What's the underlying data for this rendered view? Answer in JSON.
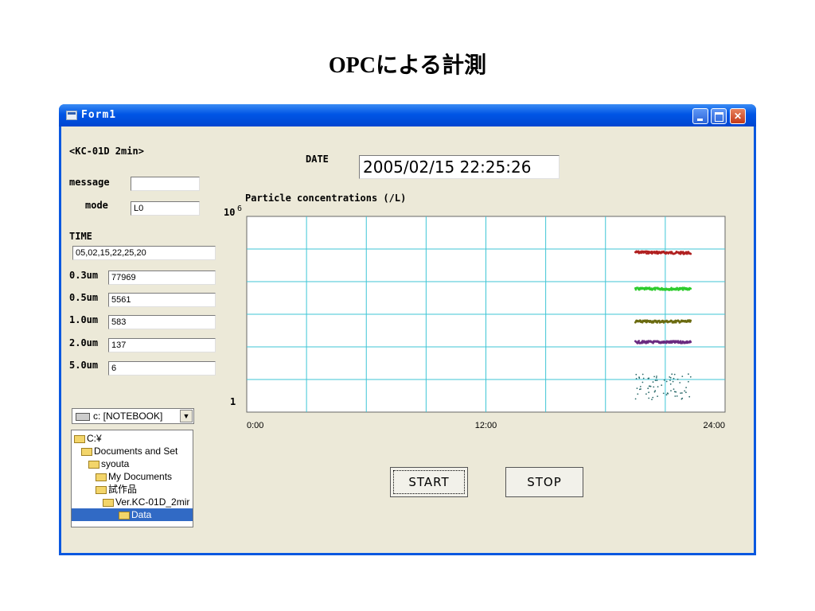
{
  "slide": {
    "title": "OPCによる計測"
  },
  "window": {
    "title": "Form1"
  },
  "form": {
    "model_label": "<KC-01D 2min>",
    "message_label": "message",
    "message_value": "",
    "mode_label": "mode",
    "mode_value": "L0",
    "time_label": "TIME",
    "time_value": "05,02,15,22,25,20",
    "date_label": "DATE",
    "date_value": "2005/02/15 22:25:26",
    "counts": [
      {
        "label": "0.3um",
        "value": "77969"
      },
      {
        "label": "0.5um",
        "value": "5561"
      },
      {
        "label": "1.0um",
        "value": "583"
      },
      {
        "label": "2.0um",
        "value": "137"
      },
      {
        "label": "5.0um",
        "value": "6"
      }
    ]
  },
  "drive": {
    "selected": "c: [NOTEBOOK]"
  },
  "directories": [
    {
      "name": "C:¥",
      "level": 0
    },
    {
      "name": "Documents and Set",
      "level": 1
    },
    {
      "name": "syouta",
      "level": 2
    },
    {
      "name": "My Documents",
      "level": 3
    },
    {
      "name": "試作品",
      "level": 3
    },
    {
      "name": "Ver.KC-01D_2mir",
      "level": 4
    },
    {
      "name": "Data",
      "level": 4,
      "selected": true
    }
  ],
  "buttons": {
    "start": "START",
    "stop": "STOP"
  },
  "chart_data": {
    "type": "scatter",
    "title": "Particle concentrations (/L)",
    "y_scale": "log",
    "ylim": [
      1,
      1000000
    ],
    "y_top_label_base": "10",
    "y_top_label_exp": "6",
    "y_bottom_label": "1",
    "x_tick_labels": [
      "0:00",
      "12:00",
      "24:00"
    ],
    "xlim_hours": [
      0,
      24
    ],
    "grid": true,
    "series": [
      {
        "size": "0.3um",
        "color": "#b02020",
        "x_start_hours": 19.5,
        "x_end_hours": 22.3,
        "y_approx": 80000
      },
      {
        "size": "0.5um",
        "color": "#2ecc2e",
        "x_start_hours": 19.5,
        "x_end_hours": 22.3,
        "y_approx": 6000
      },
      {
        "size": "1.0um",
        "color": "#6b6b10",
        "x_start_hours": 19.5,
        "x_end_hours": 22.3,
        "y_approx": 600
      },
      {
        "size": "2.0um",
        "color": "#6a2a80",
        "x_start_hours": 19.5,
        "x_end_hours": 22.3,
        "y_approx": 140
      },
      {
        "size": "5.0um",
        "color": "#2a6a6a",
        "x_start_hours": 19.5,
        "x_end_hours": 22.3,
        "y_approx": 6
      }
    ]
  }
}
